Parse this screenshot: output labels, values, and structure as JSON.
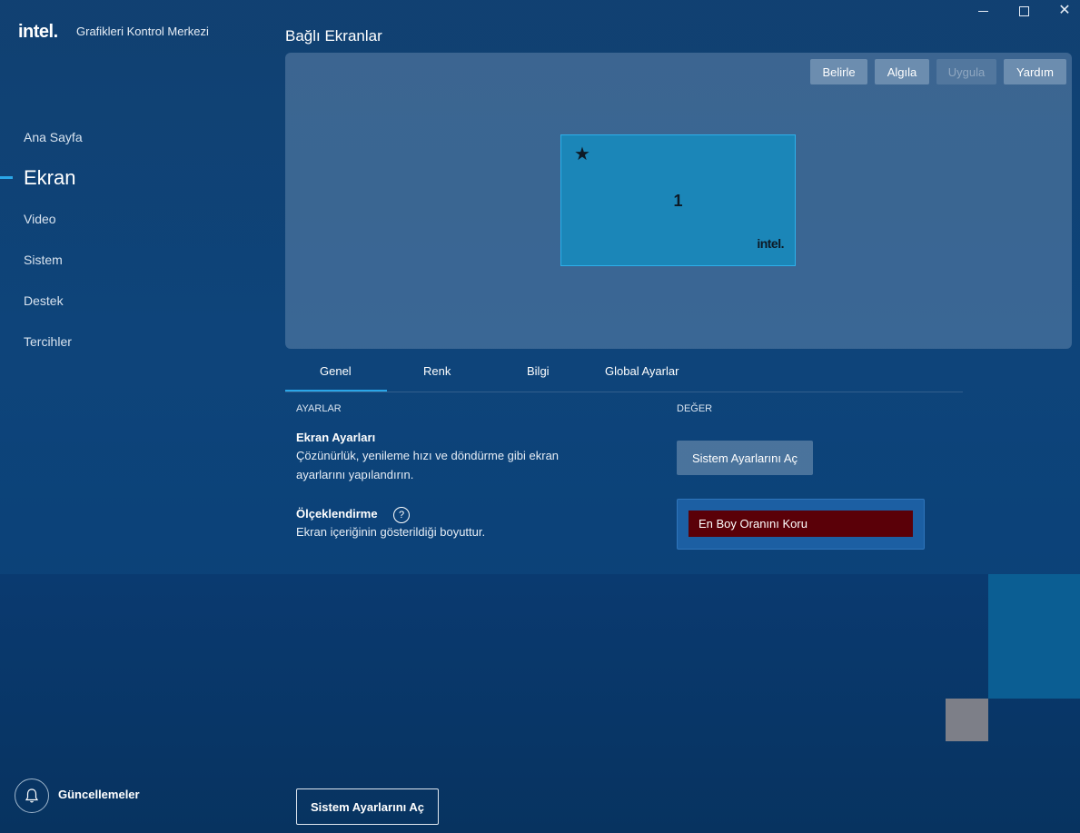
{
  "app": {
    "logo_text": "intel.",
    "title": "Grafikleri Kontrol Merkezi"
  },
  "sidebar": {
    "items": [
      {
        "label": "Ana Sayfa"
      },
      {
        "label": "Ekran",
        "active": true
      },
      {
        "label": "Video"
      },
      {
        "label": "Sistem"
      },
      {
        "label": "Destek"
      },
      {
        "label": "Tercihler"
      }
    ],
    "updates_label": "Güncellemeler"
  },
  "main": {
    "section_title": "Bağlı Ekranlar",
    "toolbar": {
      "identify_label": "Belirle",
      "detect_label": "Algıla",
      "apply_label": "Uygula",
      "help_label": "Yardım"
    },
    "monitor": {
      "number": "1",
      "brand": "intel.",
      "primary_icon": "star-icon"
    },
    "tabs": [
      {
        "label": "Genel",
        "active": true
      },
      {
        "label": "Renk"
      },
      {
        "label": "Bilgi"
      },
      {
        "label": "Global Ayarlar"
      }
    ],
    "columns": {
      "settings": "AYARLAR",
      "value": "DEĞER"
    },
    "settings": {
      "display": {
        "title": "Ekran Ayarları",
        "desc": "Çözünürlük, yenileme hızı ve döndürme gibi ekran ayarlarını yapılandırın.",
        "button": "Sistem Ayarlarını Aç"
      },
      "scaling": {
        "title": "Ölçeklendirme",
        "desc": "Ekran içeriğinin gösterildiği boyuttur.",
        "selected": "En Boy Oranını Koru"
      }
    },
    "bottom_button": "Sistem Ayarlarını Aç"
  },
  "colors": {
    "accent": "#2aa6e8",
    "monitor_fill": "#1b86b8",
    "select_bg": "#5a0008"
  }
}
